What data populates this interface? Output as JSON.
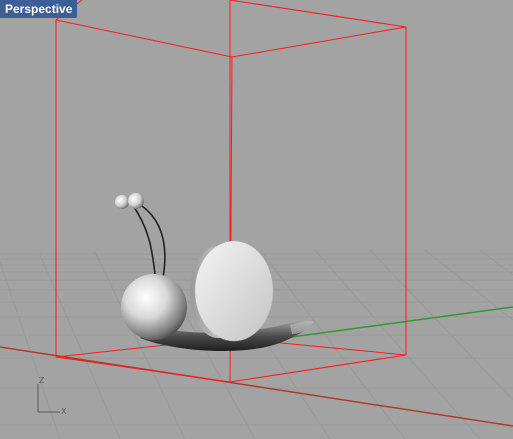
{
  "viewport": {
    "title": "Perspective",
    "background_color": "#a3a3a3",
    "grid_color": "#9a9a9a",
    "bounding_box_color": "#ff1a1a",
    "x_axis_color": "#b03a2a",
    "y_axis_color": "#2f9a2f"
  },
  "axis_icon": {
    "z_label": "Z",
    "x_label": "X"
  },
  "scene": {
    "object": "snail-model",
    "parts": [
      "shell",
      "body",
      "head",
      "left-eye-ball",
      "right-eye-ball",
      "antenna-left",
      "antenna-right"
    ]
  }
}
